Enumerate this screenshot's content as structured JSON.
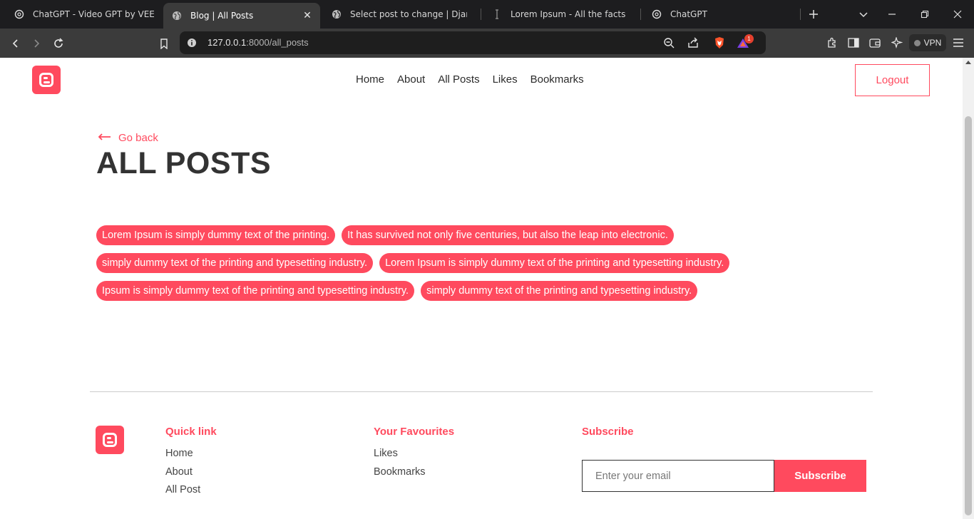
{
  "browser": {
    "tabs": [
      {
        "title": "ChatGPT - Video GPT by VEED",
        "icon": "chatgpt-icon"
      },
      {
        "title": "Blog | All Posts",
        "icon": "globe-icon"
      },
      {
        "title": "Select post to change | Django si",
        "icon": "globe-icon"
      },
      {
        "title": "Lorem Ipsum - All the facts - Lips",
        "icon": "lipsum-icon"
      },
      {
        "title": "ChatGPT",
        "icon": "chatgpt-icon"
      }
    ],
    "url_host": "127.0.0.1",
    "url_path": ":8000/all_posts",
    "vpn_label": "VPN",
    "notification_count": "1"
  },
  "header": {
    "nav": [
      "Home",
      "About",
      "All Posts",
      "Likes",
      "Bookmarks"
    ],
    "logout_label": "Logout"
  },
  "main": {
    "go_back_label": "Go back",
    "title": "ALL POSTS",
    "posts": [
      [
        "Lorem Ipsum is simply dummy text of the printing.",
        "It has survived not only five centuries, but also the leap into electronic."
      ],
      [
        "simply dummy text of the printing and typesetting industry.",
        "Lorem Ipsum is simply dummy text of the printing and typesetting industry."
      ],
      [
        "Ipsum is simply dummy text of the printing and typesetting industry.",
        "simply dummy text of the printing and typesetting industry."
      ]
    ]
  },
  "footer": {
    "quick_link": {
      "heading": "Quick link",
      "links": [
        "Home",
        "About",
        "All Post"
      ]
    },
    "favourites": {
      "heading": "Your Favourites",
      "links": [
        "Likes",
        "Bookmarks"
      ]
    },
    "subscribe": {
      "heading": "Subscribe",
      "placeholder": "Enter your email",
      "button_label": "Subscribe"
    }
  },
  "colors": {
    "accent": "#ff4a5e",
    "text": "#333333"
  }
}
